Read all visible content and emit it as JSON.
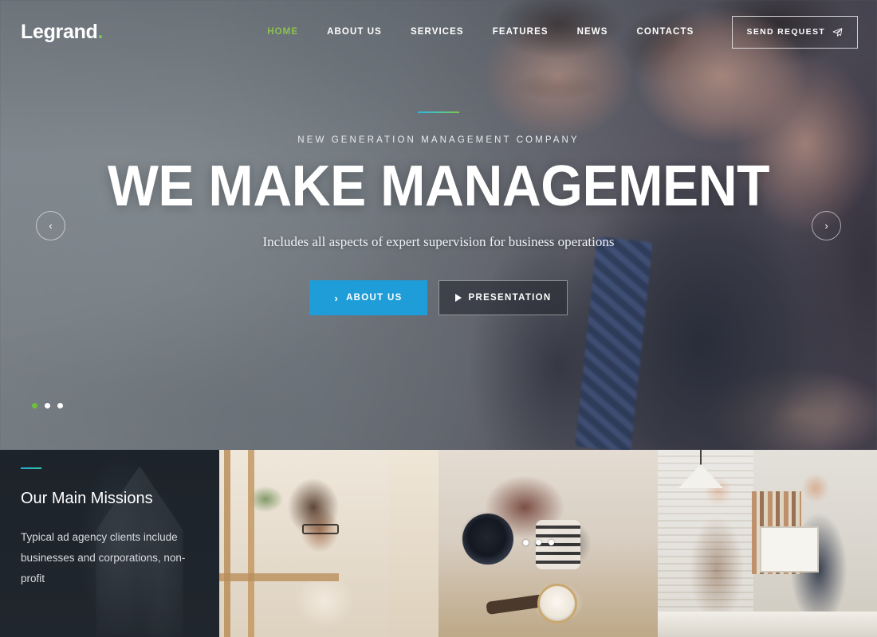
{
  "header": {
    "logo_text": "Legrand",
    "logo_dot": ".",
    "nav": [
      {
        "label": "HOME",
        "active": true
      },
      {
        "label": "ABOUT US",
        "active": false
      },
      {
        "label": "SERVICES",
        "active": false
      },
      {
        "label": "FEATURES",
        "active": false
      },
      {
        "label": "NEWS",
        "active": false
      },
      {
        "label": "CONTACTS",
        "active": false
      }
    ],
    "cta": {
      "label": "SEND REQUEST",
      "icon": "paper-plane-icon"
    }
  },
  "hero": {
    "eyebrow": "NEW GENERATION MANAGEMENT COMPANY",
    "headline": "WE MAKE MANAGEMENT",
    "subheadline": "Includes all aspects of expert supervision for business operations",
    "primary_button": {
      "label": "ABOUT US",
      "icon": "chevron-right-icon"
    },
    "secondary_button": {
      "label": "PRESENTATION",
      "icon": "play-icon"
    },
    "prev_arrow": "‹",
    "next_arrow": "›",
    "slides": [
      {
        "active": true
      },
      {
        "active": false
      },
      {
        "active": false
      }
    ]
  },
  "missions": {
    "title": "Our Main Missions",
    "text": "Typical ad agency clients include businesses and corporations, non-profit"
  },
  "gallery": {
    "panels": [
      {
        "name": "woman-at-window-photo"
      },
      {
        "name": "vintage-camera-desk-photo",
        "dots": [
          {
            "active": false
          },
          {
            "active": false
          },
          {
            "active": false
          }
        ]
      },
      {
        "name": "business-handshake-photo"
      }
    ]
  },
  "colors": {
    "accent_green": "#8cc152",
    "accent_blue": "#1e9dd8",
    "accent_teal": "#36c2a5",
    "dark_panel": "#1e242b"
  }
}
